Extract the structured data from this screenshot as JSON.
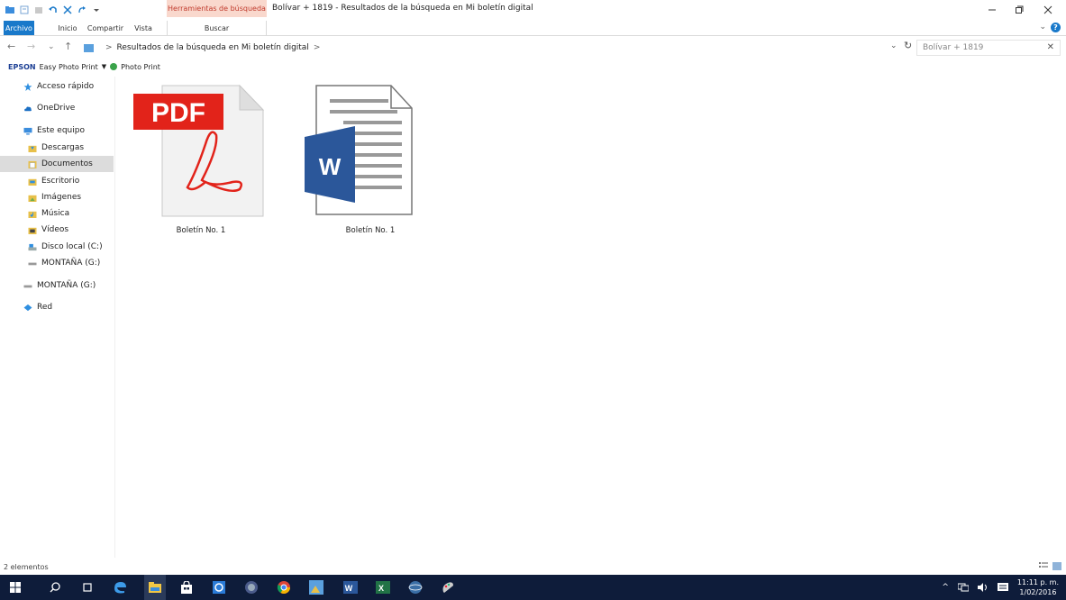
{
  "window": {
    "context_tab_header": "Herramientas de búsqueda",
    "title": "Bolívar + 1819 - Resultados de la búsqueda en Mi boletín digital"
  },
  "ribbon": {
    "tabs": [
      "Archivo",
      "Inicio",
      "Compartir",
      "Vista",
      "Buscar"
    ]
  },
  "address": {
    "path": "Resultados de la búsqueda en Mi boletín digital",
    "separator": ">",
    "search_value": "Bolívar + 1819"
  },
  "epson_bar": {
    "brand": "EPSON",
    "easy_photo_print": "Easy Photo Print",
    "photo_print": "Photo Print"
  },
  "sidebar": {
    "items": [
      {
        "label": "Acceso rápido",
        "icon": "star-icon"
      },
      {
        "label": "OneDrive",
        "icon": "cloud-icon"
      },
      {
        "label": "Este equipo",
        "icon": "computer-icon"
      },
      {
        "label": "Descargas",
        "icon": "download-folder-icon"
      },
      {
        "label": "Documentos",
        "icon": "documents-folder-icon",
        "selected": true
      },
      {
        "label": "Escritorio",
        "icon": "desktop-folder-icon"
      },
      {
        "label": "Imágenes",
        "icon": "pictures-folder-icon"
      },
      {
        "label": "Música",
        "icon": "music-folder-icon"
      },
      {
        "label": "Vídeos",
        "icon": "videos-folder-icon"
      },
      {
        "label": "Disco local (C:)",
        "icon": "local-disk-icon"
      },
      {
        "label": "MONTAÑA (G:)",
        "icon": "usb-drive-icon"
      },
      {
        "label": "MONTAÑA (G:)",
        "icon": "usb-drive-icon"
      },
      {
        "label": "Red",
        "icon": "network-icon"
      }
    ]
  },
  "files": [
    {
      "name": "Boletín No. 1",
      "type": "pdf",
      "badge": "PDF"
    },
    {
      "name": "Boletín No. 1",
      "type": "word",
      "badge": "W"
    }
  ],
  "status": {
    "count": "2 elementos"
  },
  "taskbar": {
    "time": "11:11 p. m.",
    "date": "1/02/2016"
  },
  "colors": {
    "accent": "#1979ca",
    "context_tab": "#f9d8cd",
    "pdf_red": "#e2231a",
    "word_blue": "#2b579a",
    "taskbar": "#0e1c3a",
    "selected_nav": "#dcdcdc"
  }
}
